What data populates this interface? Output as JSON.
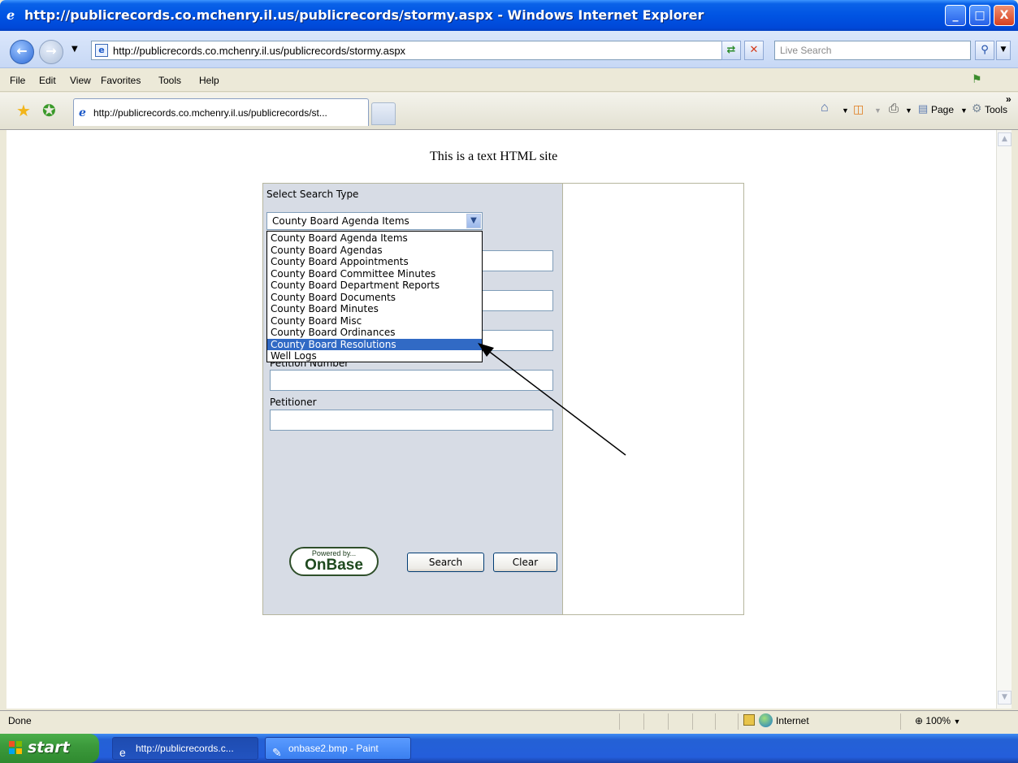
{
  "window": {
    "title": "http://publicrecords.co.mchenry.il.us/publicrecords/stormy.aspx - Windows Internet Explorer",
    "minimize": "_",
    "maximize": "□",
    "close": "X"
  },
  "addressbar": {
    "url": "http://publicrecords.co.mchenry.il.us/publicrecords/stormy.aspx",
    "search_placeholder": "Live Search"
  },
  "menu": [
    "File",
    "Edit",
    "View",
    "Favorites",
    "Tools",
    "Help"
  ],
  "tab": {
    "label": "http://publicrecords.co.mchenry.il.us/publicrecords/st..."
  },
  "commandbar": {
    "page": "Page",
    "tools": "Tools"
  },
  "page": {
    "heading": "This is a text HTML site",
    "select_label": "Select Search Type",
    "selected_value": "County Board Agenda Items",
    "options": [
      "County Board Agenda Items",
      "County Board Agendas",
      "County Board Appointments",
      "County Board Committee Minutes",
      "County Board Department Reports",
      "County Board Documents",
      "County Board Minutes",
      "County Board Misc",
      "County Board Ordinances",
      "County Board Resolutions",
      "Well Logs"
    ],
    "highlighted_option": "County Board Resolutions",
    "fields": [
      {
        "label": "Petition Number"
      },
      {
        "label": "Petitioner"
      }
    ],
    "logo_small": "Powered by...",
    "logo_big": "OnBase",
    "search_button": "Search",
    "clear_button": "Clear"
  },
  "status": {
    "text": "Done",
    "zone": "Internet",
    "zoom": "100%"
  },
  "taskbar": {
    "start": "start",
    "tasks": [
      "http://publicrecords.c...",
      "onbase2.bmp - Paint"
    ]
  },
  "colors": {
    "titlebar": "#0054e3",
    "panel": "#d7dce5",
    "selection": "#316ac5"
  }
}
